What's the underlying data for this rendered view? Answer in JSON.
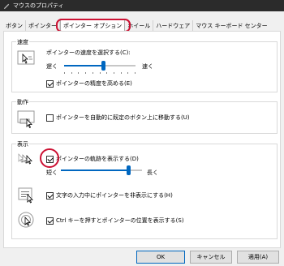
{
  "window": {
    "title": "マウスのプロパティ"
  },
  "tabs": [
    {
      "label": "ボタン"
    },
    {
      "label": "ポインター"
    },
    {
      "label": "ポインター オプション"
    },
    {
      "label": "ホイール"
    },
    {
      "label": "ハードウェア"
    },
    {
      "label": "マウス キーボード センター"
    }
  ],
  "motion": {
    "title": "速度",
    "label": "ポインターの速度を選択する(C):",
    "slow": "遅く",
    "fast": "速く",
    "speed_value": 0.55,
    "precision_label": "ポインターの精度を高める(E)",
    "precision_checked": true
  },
  "snap": {
    "title": "動作",
    "label": "ポインターを自動的に既定のボタン上に移動する(U)",
    "checked": false
  },
  "visibility": {
    "title": "表示",
    "trails_label": "ポインターの軌跡を表示する(D)",
    "trails_checked": true,
    "short": "短く",
    "long": "長く",
    "trails_value": 0.85,
    "hide_label": "文字の入力中にポインターを非表示にする(H)",
    "hide_checked": true,
    "ctrl_label": "Ctrl キーを押すとポインターの位置を表示する(S)",
    "ctrl_checked": true
  },
  "buttons": {
    "ok": "OK",
    "cancel": "キャンセル",
    "apply": "適用(A)"
  },
  "colors": {
    "accent": "#0067c0",
    "highlight_ring": "#cc1133"
  }
}
